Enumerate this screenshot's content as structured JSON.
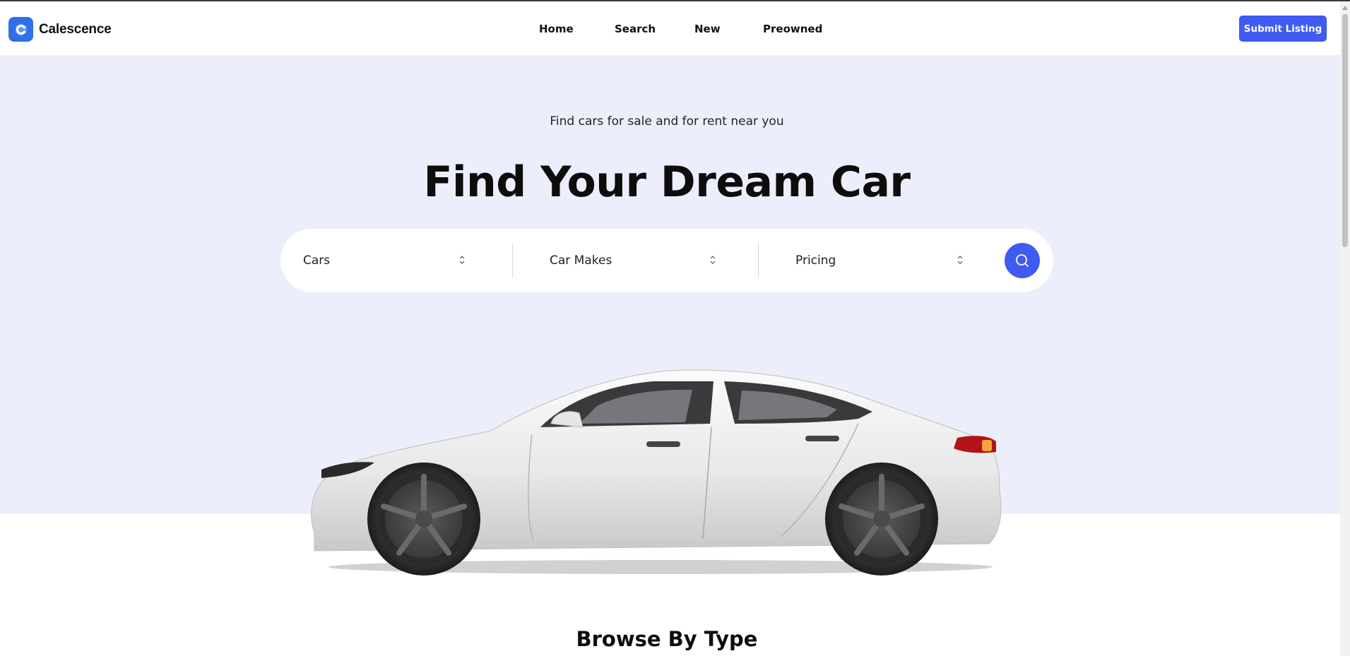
{
  "brand": {
    "name": "Calescence",
    "accent": "#3f5bf2",
    "logo_color": "#2f6fe8"
  },
  "nav": {
    "items": [
      "Home",
      "Search",
      "New",
      "Preowned"
    ],
    "cta": "Submit Listing"
  },
  "hero": {
    "subtitle": "Find cars for sale and for rent near you",
    "title": "Find Your Dream Car",
    "background": "#eceffb",
    "search": {
      "fields": [
        {
          "label": "Cars",
          "icon": "chevron-updown-icon"
        },
        {
          "label": "Car Makes",
          "icon": "chevron-updown-icon"
        },
        {
          "label": "Pricing",
          "icon": "chevron-updown-icon"
        }
      ],
      "button_icon": "search-icon"
    },
    "image": "white-sedan-side-view"
  },
  "browse": {
    "title": "Browse By Type"
  }
}
